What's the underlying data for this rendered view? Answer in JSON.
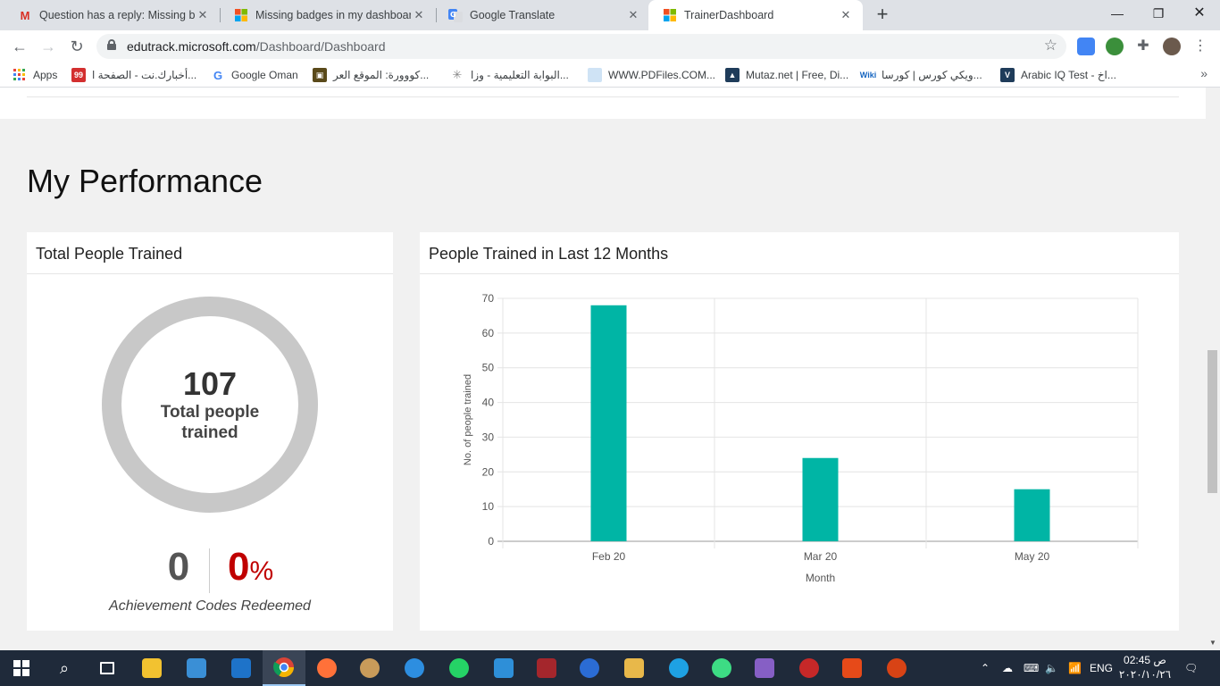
{
  "browser": {
    "tabs": [
      {
        "title": "Question has a reply: Missing badges",
        "favicon": "gmail-icon",
        "active": false
      },
      {
        "title": "Missing badges in my dashboard",
        "favicon": "microsoft-icon",
        "active": false
      },
      {
        "title": "Google Translate",
        "favicon": "translate-icon",
        "active": false
      },
      {
        "title": "TrainerDashboard",
        "favicon": "microsoft-icon",
        "active": true
      }
    ],
    "url_host": "edutrack.microsoft.com",
    "url_path": "/Dashboard/Dashboard",
    "bookmarks": [
      "Apps",
      "أخبارك.نت - الصفحة ا...",
      "Google Oman",
      "كووورة: الموقع العر...",
      "البوابة التعليمية - وزا...",
      "WWW.PDFiles.COM...",
      "Mutaz.net | Free, Di...",
      "ويكي كورس | كورسا...",
      "Arabic IQ Test - اخ..."
    ]
  },
  "page": {
    "heading": "My Performance",
    "total_card": {
      "title": "Total People Trained",
      "total": "107",
      "total_label": "Total people trained",
      "codes_redeemed": "0",
      "codes_percent": "0",
      "percent_symbol": "%",
      "codes_caption": "Achievement Codes Redeemed"
    },
    "chart_card": {
      "title": "People Trained in Last 12 Months"
    }
  },
  "chart_data": {
    "type": "bar",
    "categories": [
      "Feb 20",
      "Mar 20",
      "May 20"
    ],
    "values": [
      68,
      24,
      15
    ],
    "xlabel": "Month",
    "ylabel": "No. of people trained",
    "ylim": [
      0,
      70
    ],
    "yticks": [
      0,
      10,
      20,
      30,
      40,
      50,
      60,
      70
    ],
    "bar_color": "#00b5a5",
    "grid": true
  },
  "taskbar": {
    "lang": "ENG",
    "time": "02:45 ص",
    "date": "٢٠٢٠/١٠/٢٦"
  },
  "colors": {
    "accent_red": "#c00000",
    "donut_ring": "#c8c8c8",
    "bar": "#00b5a5"
  }
}
